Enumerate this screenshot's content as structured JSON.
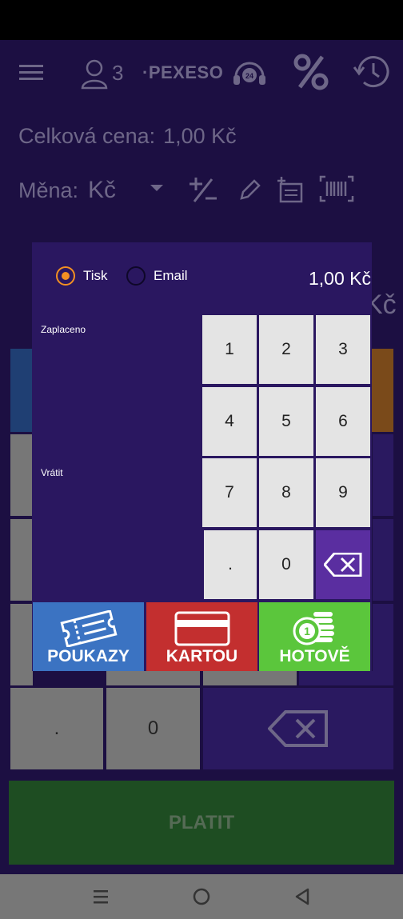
{
  "toolbar": {
    "user_count": "3",
    "logo_text": "·PEXESO",
    "icons": [
      "menu-icon",
      "user-icon",
      "headset-24-icon",
      "percent-icon",
      "history-icon"
    ]
  },
  "summary": {
    "total_label": "Celková cena:",
    "total_value": "1,00 Kč",
    "currency_label": "Měna:",
    "currency_value": "Kč"
  },
  "background": {
    "large_currency": "Kč",
    "keypad_dot": ".",
    "keypad_zero": "0",
    "pay_button": "PLATIT"
  },
  "dialog": {
    "radio_print": "Tisk",
    "radio_email": "Email",
    "amount": "1,00 Kč",
    "paid_label": "Zaplaceno",
    "change_label": "Vrátit",
    "keys": [
      "1",
      "2",
      "3",
      "4",
      "5",
      "6",
      "7",
      "8",
      "9",
      ".",
      "0"
    ],
    "methods": {
      "vouchers": "POUKAZY",
      "card": "KARTOU",
      "cash": "HOTOVĚ"
    }
  },
  "colors": {
    "accent": "#f39022",
    "dialog_bg": "#2a1760",
    "vouchers": "#3b73c2",
    "card": "#c32f2f",
    "cash": "#5bc63c"
  }
}
